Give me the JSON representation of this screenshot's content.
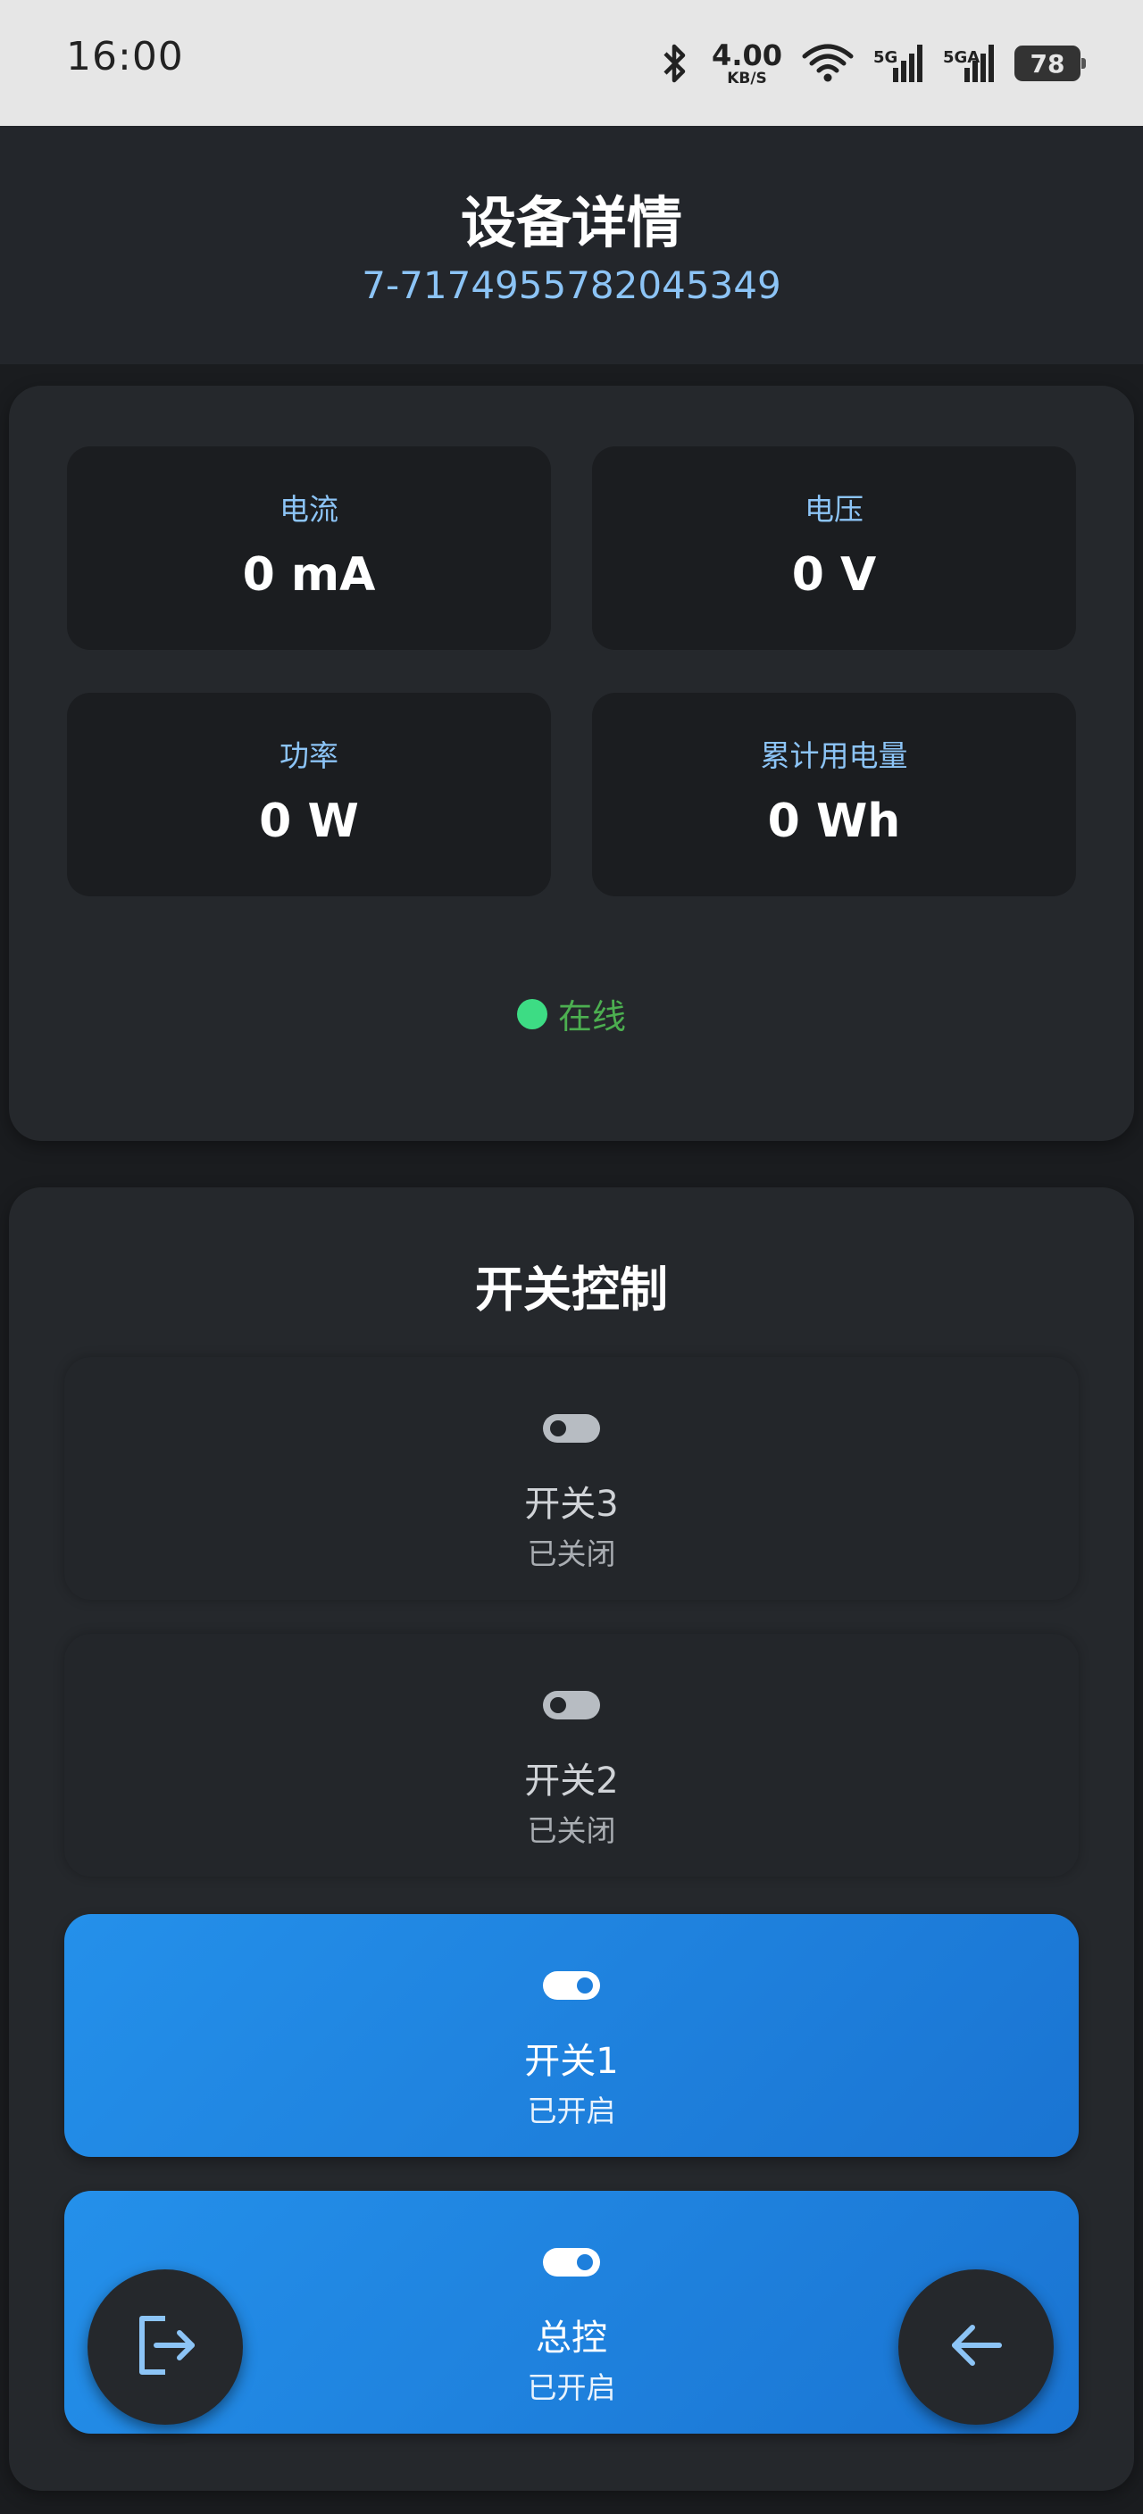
{
  "status_bar": {
    "time": "16:00",
    "speed_value": "4.00",
    "speed_unit": "KB/S",
    "net1": "5G",
    "net2": "5GA",
    "battery": "78",
    "icons": [
      "bluetooth-icon",
      "wifi-icon",
      "signal-icon",
      "battery-icon"
    ]
  },
  "header": {
    "title": "设备详情",
    "device_id": "7-7174955782045349"
  },
  "metrics": [
    {
      "label": "电流",
      "value": "0 mA"
    },
    {
      "label": "电压",
      "value": "0 V"
    },
    {
      "label": "功率",
      "value": "0 W"
    },
    {
      "label": "累计用电量",
      "value": "0 Wh"
    }
  ],
  "online_status": "在线",
  "switch_control": {
    "title": "开关控制",
    "switches": [
      {
        "name": "开关3",
        "state": "已关闭",
        "on": false
      },
      {
        "name": "开关2",
        "state": "已关闭",
        "on": false
      },
      {
        "name": "开关1",
        "state": "已开启",
        "on": true
      },
      {
        "name": "总控",
        "state": "已开启",
        "on": true
      }
    ]
  },
  "fabs": {
    "left_icon": "logout-icon",
    "right_icon": "arrow-left-icon"
  },
  "colors": {
    "accent": "#1e88e5",
    "online": "#3ddc84",
    "label": "#8cc4f6"
  }
}
